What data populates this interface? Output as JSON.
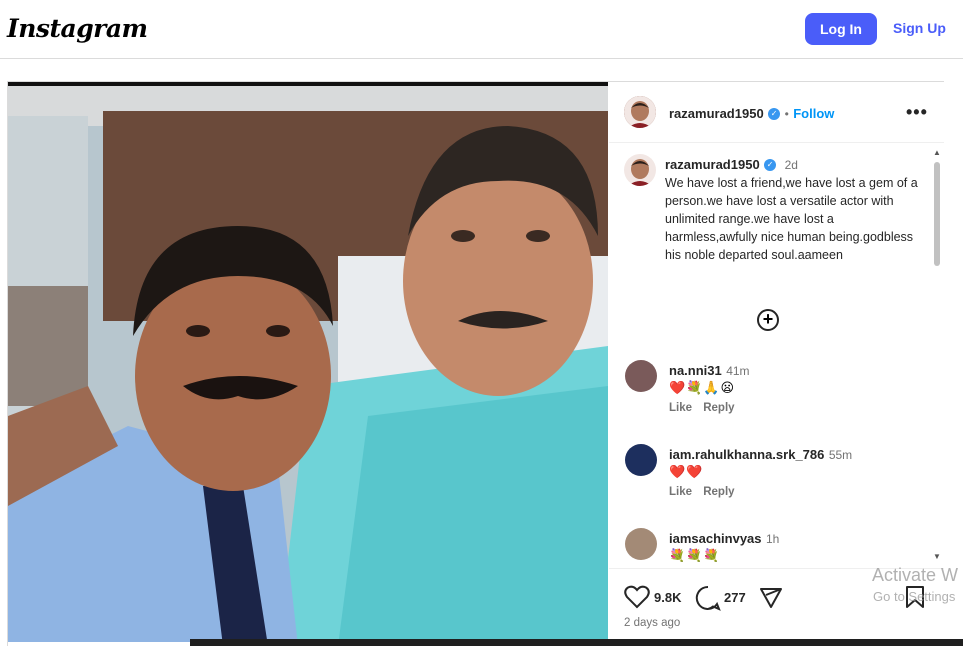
{
  "header": {
    "logo": "Instagram",
    "login_label": "Log In",
    "signup_label": "Sign Up"
  },
  "post": {
    "author": {
      "username": "razamurad1950",
      "follow_label": "Follow",
      "separator": "•"
    },
    "caption": {
      "username": "razamurad1950",
      "time": "2d",
      "text": "We have lost a friend,we have lost a gem of a person.we have lost a versatile actor with unlimited range.we have lost a harmless,awfully nice human being.godbless his noble departed soul.aameen"
    },
    "comments": [
      {
        "username": "na.nni31",
        "time": "41m",
        "text": "❤️💐🙏😦",
        "like": "Like",
        "reply": "Reply"
      },
      {
        "username": "iam.rahulkhanna.srk_786",
        "time": "55m",
        "text": "❤️❤️",
        "like": "Like",
        "reply": "Reply"
      },
      {
        "username": "iamsachinvyas",
        "time": "1h",
        "text": "💐💐💐"
      }
    ],
    "likes": "9.8K",
    "comments_count": "277",
    "posted": "2 days ago"
  },
  "overlay": {
    "activate_title": "Activate W",
    "activate_sub": "Go to Settings"
  }
}
